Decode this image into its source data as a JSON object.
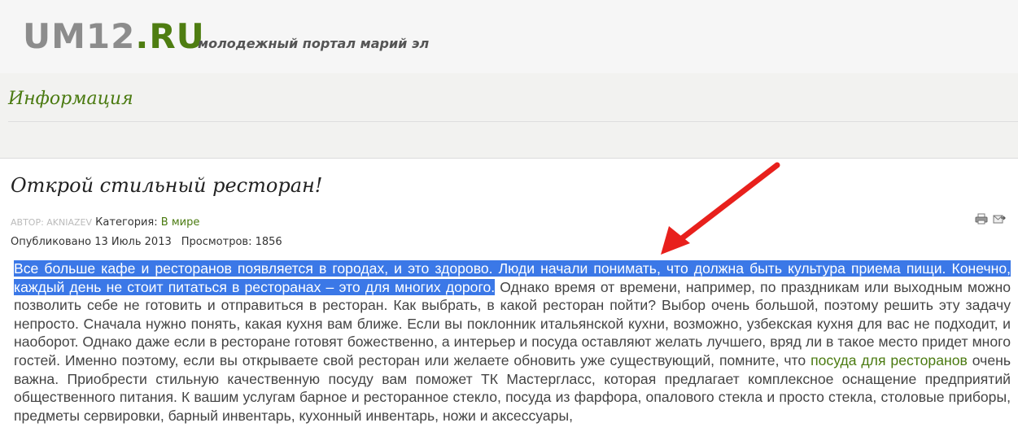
{
  "header": {
    "logo_um": "UM12",
    "logo_ru": ".RU",
    "tagline": "молодежный портал марий эл"
  },
  "section": {
    "title": "Информация"
  },
  "article": {
    "title": "Открой стильный ресторан!",
    "author_label": "АВТОР: AKNIAZEV",
    "category_label": "Категория:",
    "category_link": "В мире",
    "published": "Опубликовано 13 Июль 2013",
    "views": "Просмотров: 1856",
    "selected_text": "Все больше кафе и ресторанов появляется в городах, и это здорово. Люди начали понимать, что должна быть культура приема пищи. Конечно, каждый день не стоит питаться в ресторанах – это для многих дорого.",
    "text_before_link": " Однако время от времени, например, по праздникам или выходным можно позволить себе не готовить и отправиться в ресторан. Как выбрать, в какой ресторан пойти? Выбор очень большой, поэтому решить эту задачу непросто. Сначала нужно понять, какая кухня вам ближе. Если вы поклонник итальянской кухни, возможно, узбекская кухня для вас не подходит, и наоборот. Однако даже если в ресторане готовят божественно, а интерьер и посуда оставляют желать лучшего, вряд ли в такое место придет много гостей. Именно поэтому, если вы открываете свой ресторан или желаете обновить уже существующий, помните, что ",
    "link_text": "посуда для ресторанов",
    "text_after_link": " очень важна. Приобрести стильную качественную посуду вам поможет ТК Мастергласс, которая предлагает комплексное оснащение предприятий общественного питания. К вашим услугам барное и ресторанное стекло, посуда из фарфора, опалового стекла и просто стекла, столовые приборы, предметы сервировки, барный инвентарь, кухонный инвентарь, ножи и аксессуары,"
  },
  "icons": [
    "print-icon",
    "email-icon"
  ],
  "colors": {
    "brand_green": "#4e7d11",
    "selection": "#3b78e7",
    "arrow": "#e8201c"
  }
}
